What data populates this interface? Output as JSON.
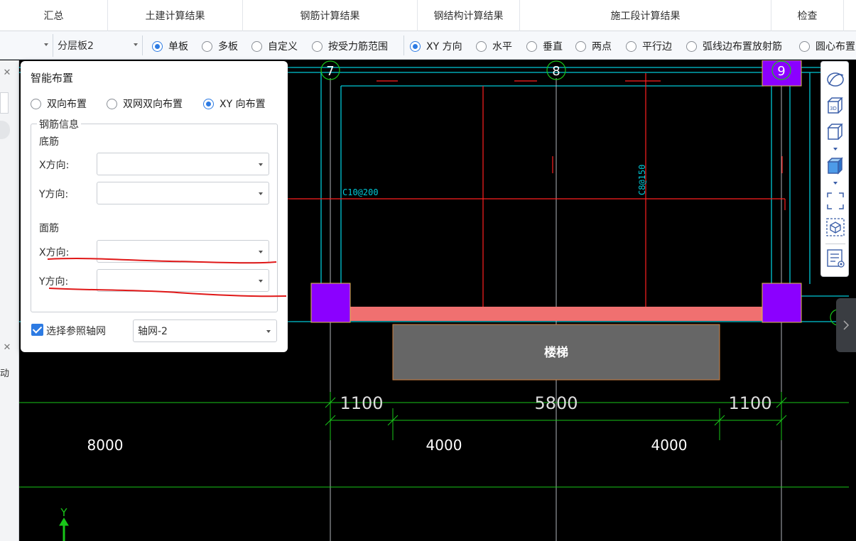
{
  "ribbon": {
    "tabs": [
      "汇总",
      "土建计算结果",
      "钢筋计算结果",
      "钢结构计算结果",
      "施工段计算结果",
      "检查"
    ]
  },
  "toolbar": {
    "layer_select": "分层板2",
    "mode_options": [
      "单板",
      "多板",
      "自定义",
      "按受力筋范围"
    ],
    "mode_selected": 0,
    "direction_options": [
      "XY 方向",
      "水平",
      "垂直",
      "两点",
      "平行边",
      "弧线边布置放射筋",
      "圆心布置"
    ],
    "direction_selected": 0
  },
  "dialog": {
    "title": "智能布置",
    "layout_options": [
      "双向布置",
      "双网双向布置",
      "XY 向布置"
    ],
    "layout_selected": 2,
    "rebar_group": "钢筋信息",
    "bottom_label": "底筋",
    "top_label": "面筋",
    "x_label": "X方向:",
    "y_label": "Y方向:",
    "bottom_x_value": "",
    "bottom_y_value": "",
    "top_x_value": "",
    "top_y_value": "",
    "grid_checkbox_label": "选择参照轴网",
    "grid_checked": true,
    "grid_value": "轴网-2"
  },
  "drawing": {
    "axis_labels": [
      "7",
      "8",
      "9"
    ],
    "rebar_label_x": "C10@200",
    "rebar_label_y": "C8@150",
    "stair_label": "楼梯",
    "dims_upper": [
      "1100",
      "5800",
      "1100"
    ],
    "dims_lower": [
      "8000",
      "4000",
      "4000"
    ],
    "y_axis_label": "Y"
  },
  "colors": {
    "grid": "#00c8d6",
    "rebar": "#ff2020",
    "column": "#8b00ff",
    "beam_fill": "#f07070",
    "dim": "#19c619",
    "accent": "#2d7be3"
  }
}
